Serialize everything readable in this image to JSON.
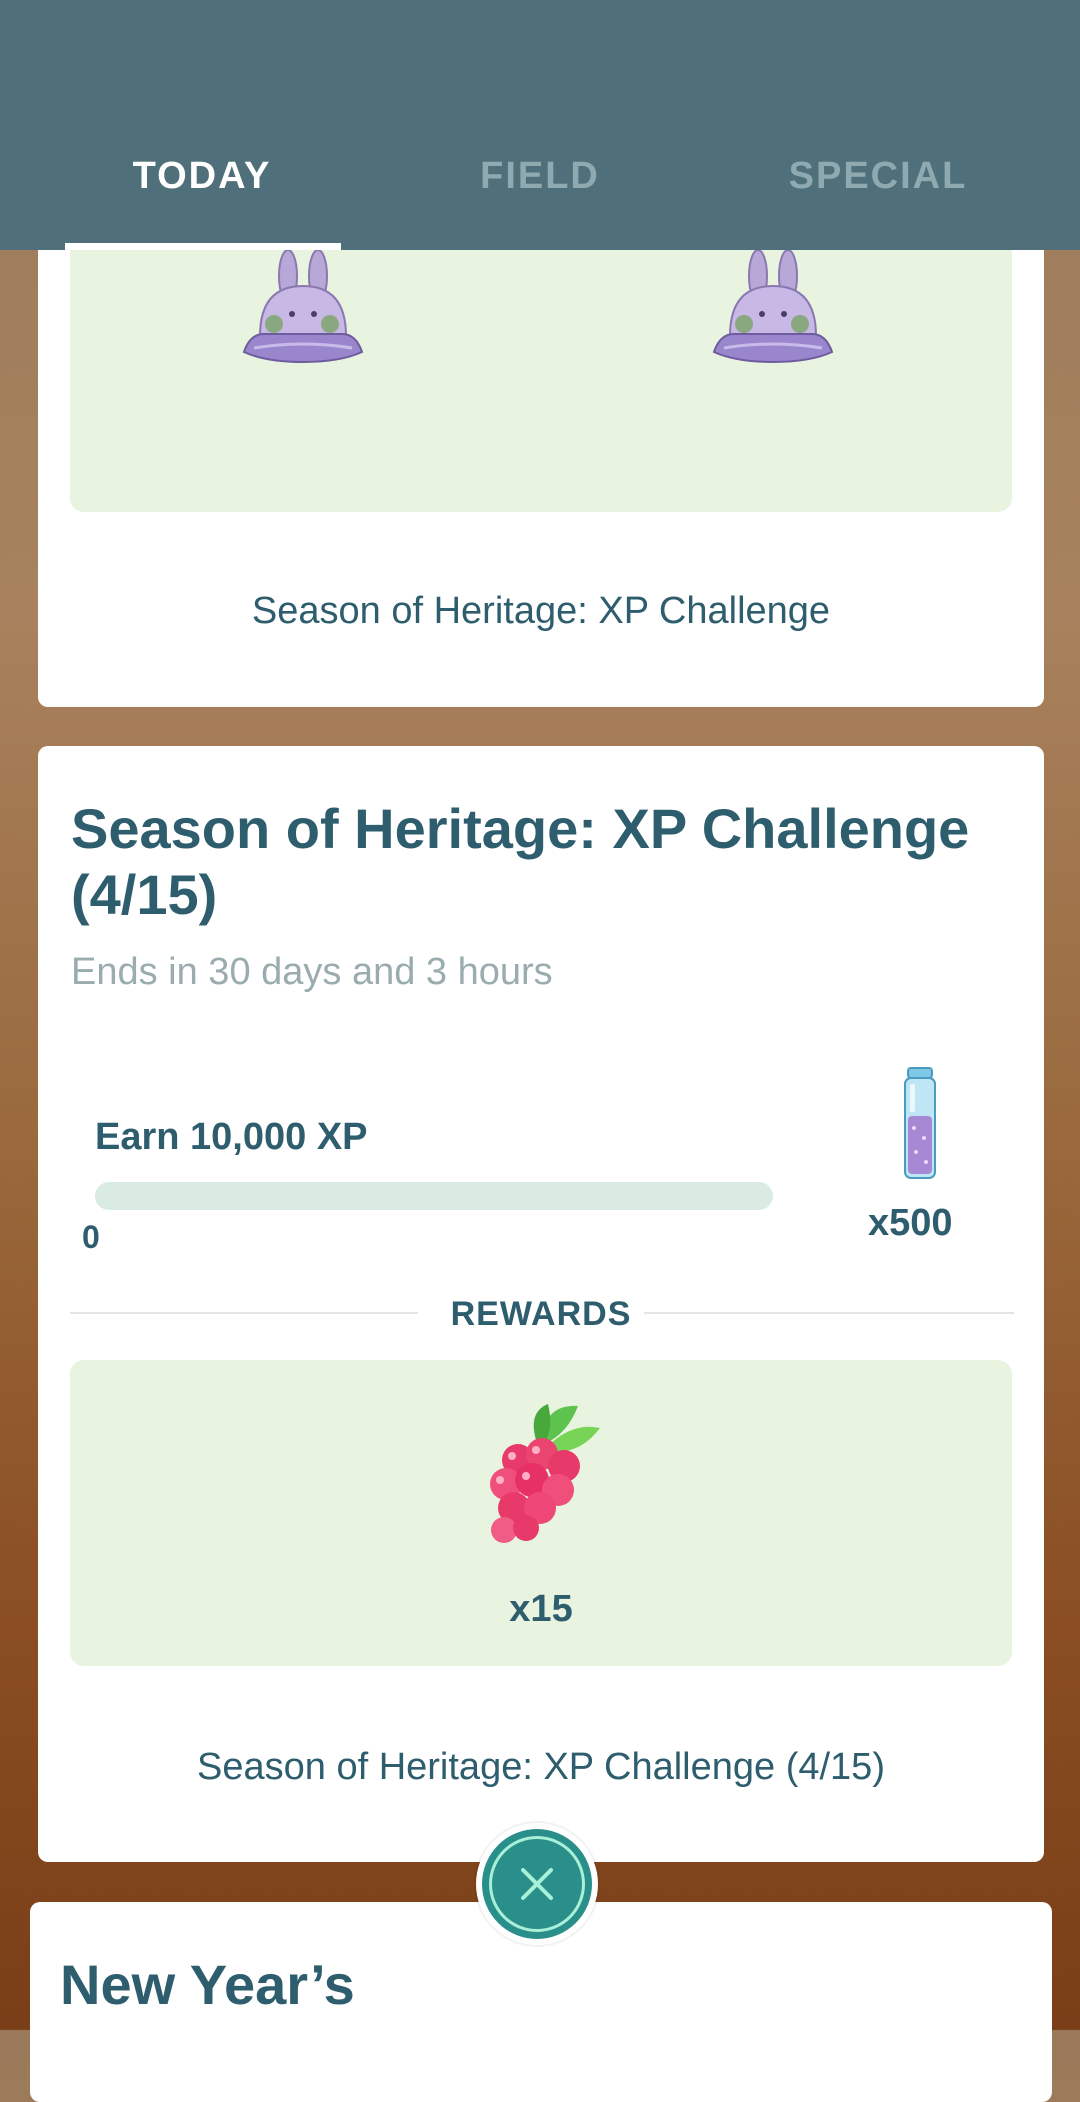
{
  "tabs": [
    {
      "label": "TODAY",
      "active": true
    },
    {
      "label": "FIELD",
      "active": false
    },
    {
      "label": "SPECIAL",
      "active": false
    }
  ],
  "card1": {
    "reward_icons": [
      "goomy-bucket-hat-icon",
      "goomy-bucket-hat-icon"
    ],
    "footer": "Season of Heritage: XP Challenge"
  },
  "card2": {
    "title": "Season of Heritage: XP Challenge (4/15)",
    "subtitle": "Ends in 30 days and 3 hours",
    "task": {
      "label": "Earn 10,000 XP",
      "progress_min": "0",
      "progress_fraction": 0,
      "reward_icon": "stardust-vial-icon",
      "reward_qty": "x500"
    },
    "rewards_label": "REWARDS",
    "reward_item": {
      "icon": "razz-berry-icon",
      "qty": "x15"
    },
    "footer": "Season of Heritage: XP Challenge (4/15)"
  },
  "close_button": {
    "icon": "close-icon"
  },
  "card3": {
    "title": "New Year’s"
  },
  "colors": {
    "header": "#4f707a",
    "text_primary": "#2e5d6e",
    "text_muted": "#9aacad",
    "reward_panel": "#e8f3e0",
    "progress_track": "#d9ebe3",
    "close_button": "#2a8f8a"
  }
}
